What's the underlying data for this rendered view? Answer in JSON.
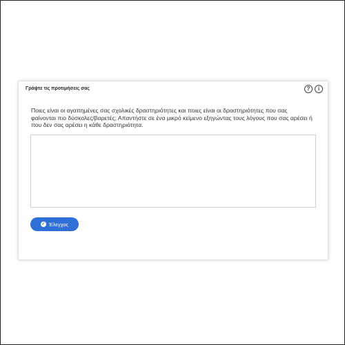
{
  "card": {
    "title": "Γράψτε τις προτιμήσεις σας",
    "question": "Ποιες είναι οι αγαπημένες σας σχολικές δραστηριότητες και ποιες είναι οι δραστηριότητες που σας φαίνονται πιο δύσκολες/βαρετές; Απαντήστε σε ένα μικρό κείμενο εξηγώντας τους λόγους που σας αρέσει ή που δεν σας αρέσει η κάθε δραστηριότητα.",
    "answer_value": "",
    "check_button_label": "Έλεγχος",
    "help_icon_glyph": "?",
    "info_icon_glyph": "i"
  },
  "colors": {
    "accent": "#2f6fd8",
    "border": "#cfcfcf"
  },
  "icons": {
    "help": "help-icon",
    "info": "info-icon",
    "check": "check-circle-icon"
  }
}
